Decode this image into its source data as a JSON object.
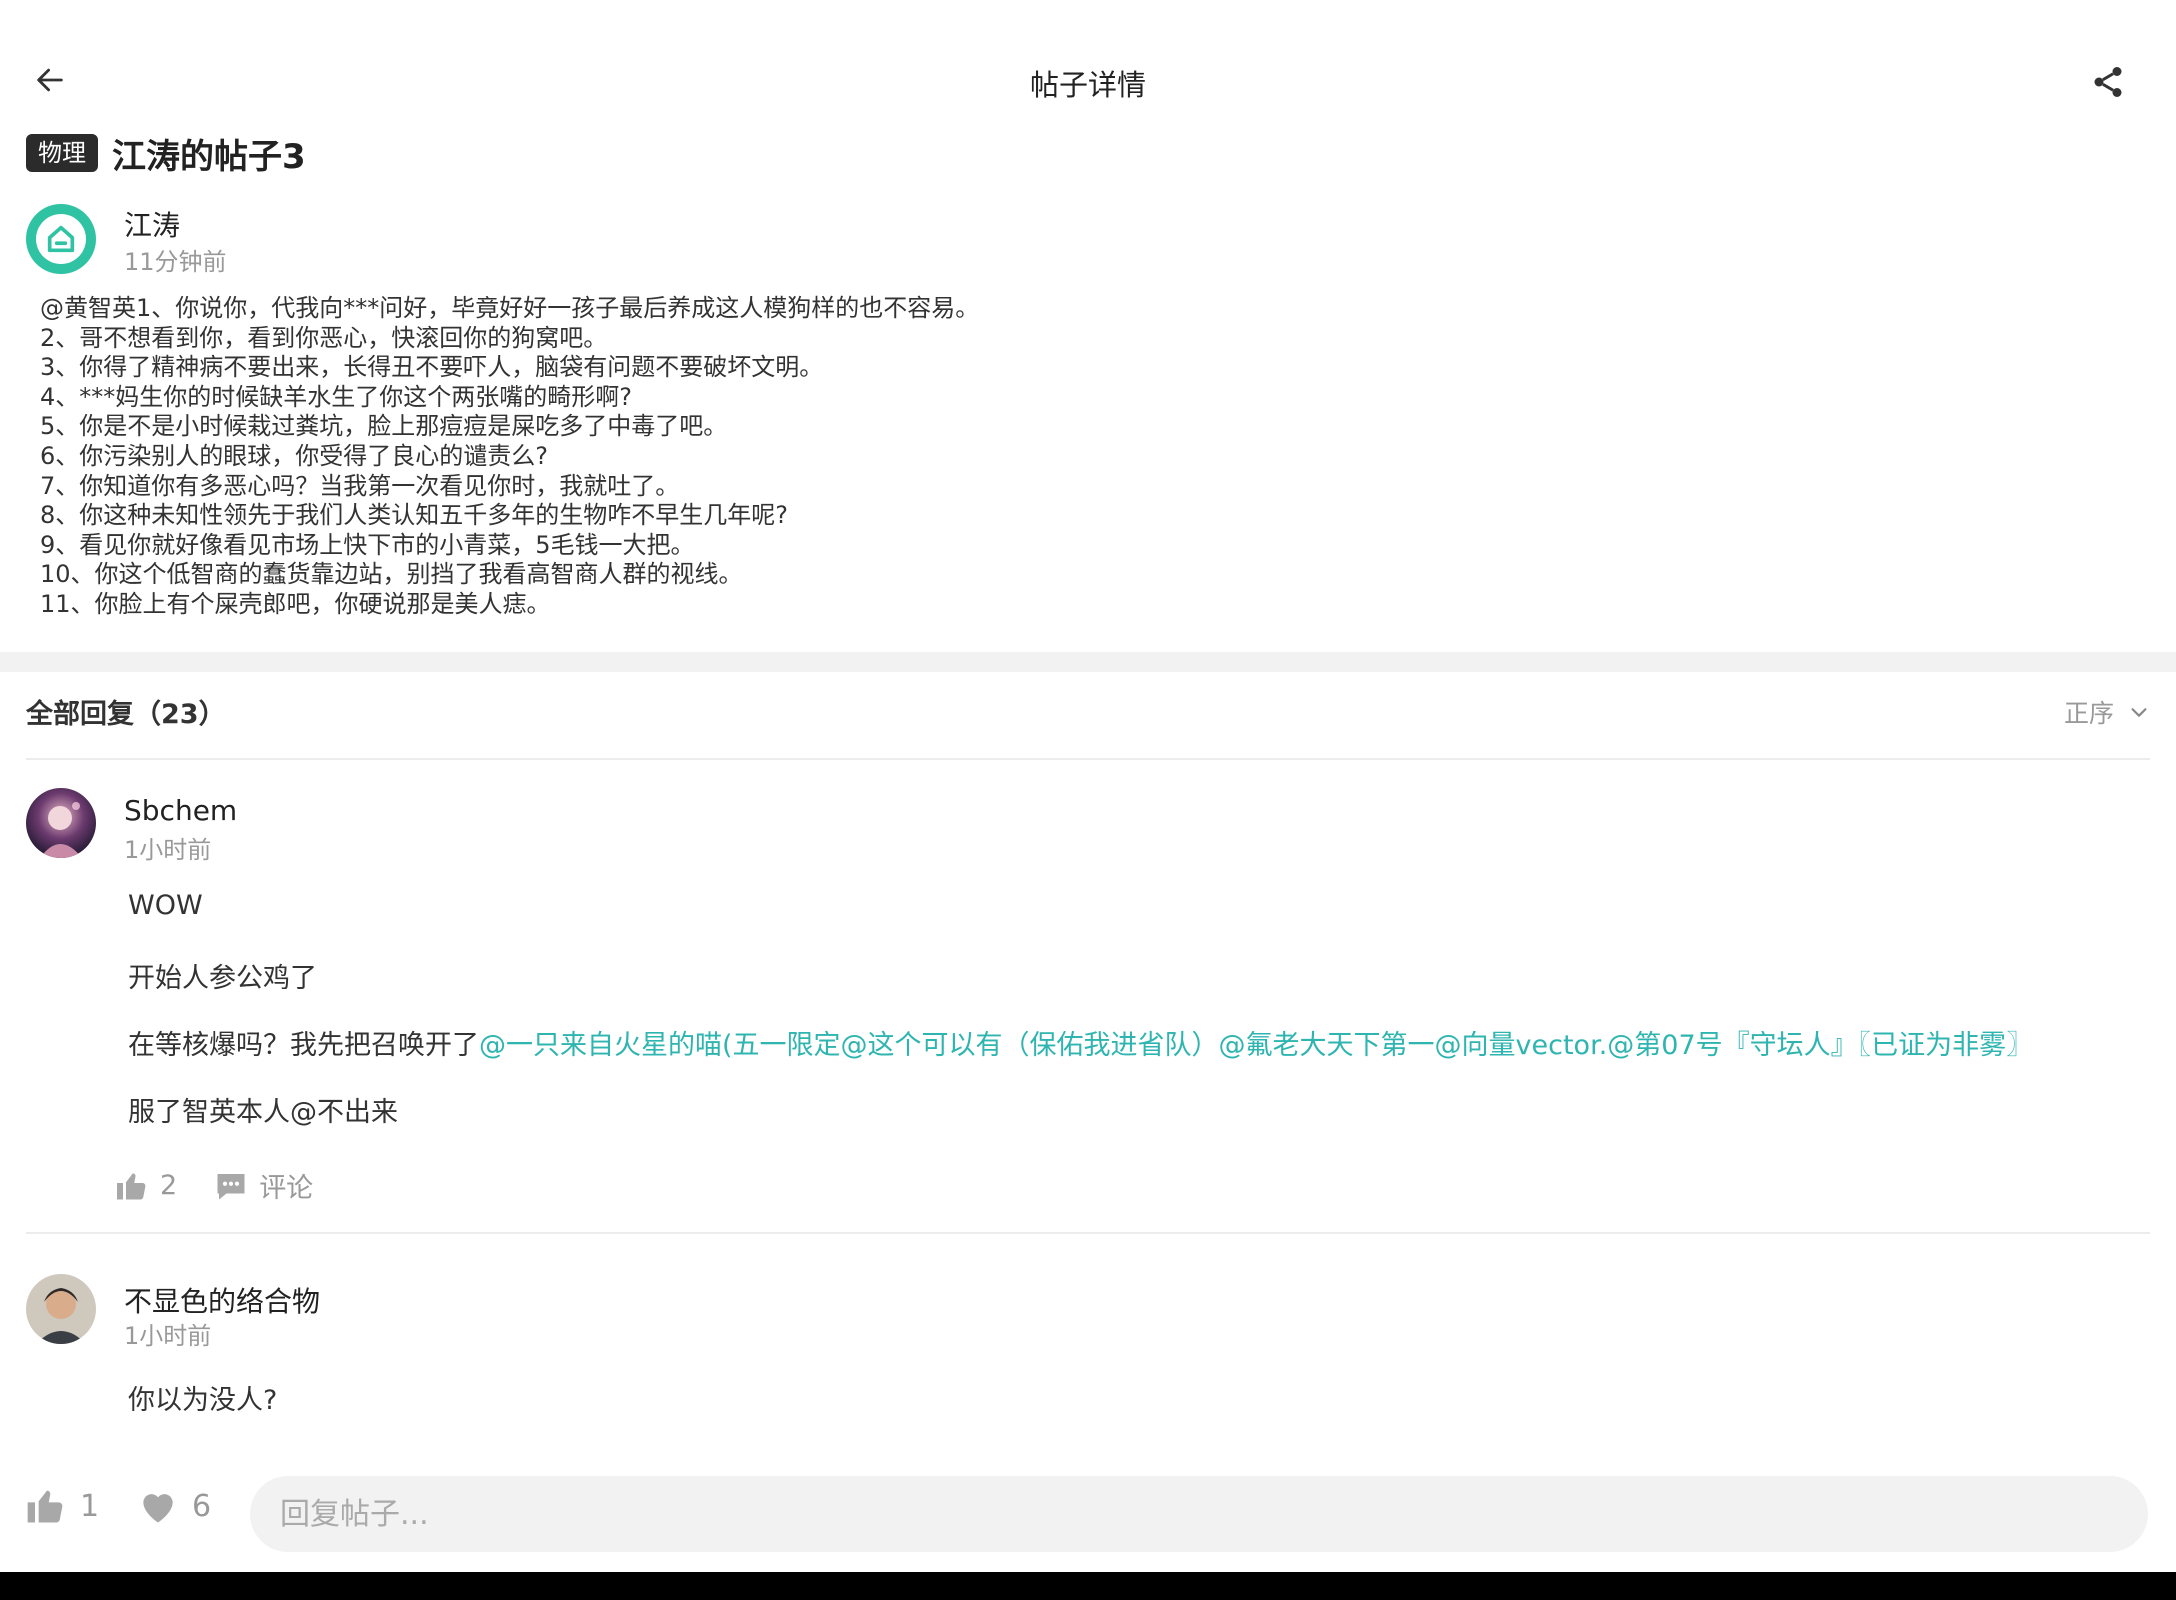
{
  "header": {
    "title": "帖子详情"
  },
  "post": {
    "tag": "物理",
    "title": "江涛的帖子3",
    "author": "江涛",
    "time": "11分钟前",
    "lines": [
      "@黄智英1、你说你，代我向***问好，毕竟好好一孩子最后养成这人模狗样的也不容易。",
      "2、哥不想看到你，看到你恶心，快滚回你的狗窝吧。",
      "3、你得了精神病不要出来，长得丑不要吓人，脑袋有问题不要破坏文明。",
      "4、***妈生你的时候缺羊水生了你这个两张嘴的畸形啊?",
      "5、你是不是小时候栽过粪坑，脸上那痘痘是屎吃多了中毒了吧。",
      "6、你污染别人的眼球，你受得了良心的谴责么?",
      "7、你知道你有多恶心吗？当我第一次看见你时，我就吐了。",
      "8、你这种未知性领先于我们人类认知五千多年的生物咋不早生几年呢?",
      "9、看见你就好像看见市场上快下市的小青菜，5毛钱一大把。",
      "10、你这个低智商的蠢货靠边站，别挡了我看高智商人群的视线。",
      "11、你脸上有个屎壳郎吧，你硬说那是美人痣。"
    ]
  },
  "replies": {
    "label": "全部回复（23）",
    "sort": "正序",
    "comments": [
      {
        "name": "Sbchem",
        "time": "1小时前",
        "p1": "WOW",
        "p2": "开始人参公鸡了",
        "p3_prefix": "在等核爆吗？我先把召唤开了",
        "p3_mentions": "@一只来自火星的喵(五一限定@这个可以有（保佑我进省队）@氟老大天下第一@向量vector.@第07号『守坛人』〖已证为非雾〗",
        "p4": "服了智英本人@不出来",
        "likes": "2",
        "comment_label": "评论"
      },
      {
        "name": "不显色的络合物",
        "time": "1小时前",
        "p1": "你以为没人?"
      }
    ]
  },
  "bottom": {
    "likes": "1",
    "favorites": "6",
    "reply_placeholder": "回复帖子..."
  },
  "colors": {
    "accent": "#2fb5b0",
    "avatar_green": "#2fc3a3",
    "tag_bg": "#2b2b2b"
  }
}
